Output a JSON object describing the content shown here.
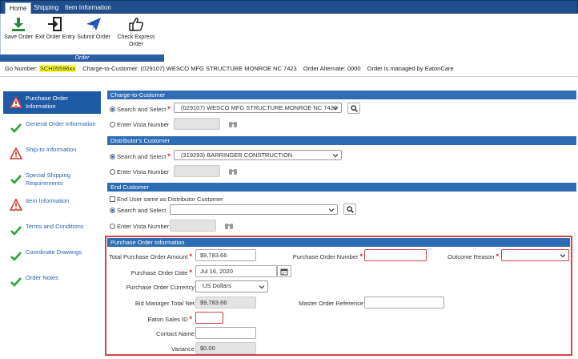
{
  "tabs": [
    "Home",
    "Shipping",
    "Item Information"
  ],
  "ribbon": {
    "buttons": [
      {
        "label": "Save Order",
        "icon": "download-icon"
      },
      {
        "label": "Exit Order Entry",
        "icon": "exit-icon"
      },
      {
        "label": "Submit Order",
        "icon": "paper-plane-icon"
      },
      {
        "label": "Check Express Order",
        "icon": "thumbs-up-icon"
      }
    ],
    "group_label": "Order"
  },
  "info": {
    "go_number_label": "Go Number:",
    "go_number": "SCH05596xx",
    "charge_to": "Charge-to-Customer: (029107) WESCO MFG STRUCTURE MONROE NC 7423",
    "order_alternate": "Order Alternate: 0000",
    "managed_by": "Order is managed by EatonCare"
  },
  "sidebar": {
    "items": [
      {
        "label": "Purchase Order Information",
        "status": "warning",
        "active": true
      },
      {
        "label": "General Order Information",
        "status": "ok"
      },
      {
        "label": "Ship-to Information",
        "status": "warning"
      },
      {
        "label": "Special Shipping Requirements",
        "status": "ok"
      },
      {
        "label": "Item Information",
        "status": "warning"
      },
      {
        "label": "Terms and Conditions",
        "status": "ok"
      },
      {
        "label": "Coordinate Drawings",
        "status": "ok"
      },
      {
        "label": "Order Notes",
        "status": "ok"
      }
    ]
  },
  "charge": {
    "title": "Charge-to-Customer",
    "search_label": "Search and Select",
    "selected": "(029107) WESCO MFG STRUCTURE MONROE NC 7423",
    "vista_label": "Enter Vista Number"
  },
  "distributor": {
    "title": "Distributor's Customer",
    "search_label": "Search and Select",
    "selected": "(319293) BARRINGER CONSTRUCTION",
    "vista_label": "Enter Vista Number"
  },
  "end_customer": {
    "title": "End Customer",
    "same_label": "End User same as Distributor Customer",
    "search_label": "Search and Select",
    "selected": "",
    "vista_label": "Enter Vista Number"
  },
  "po": {
    "title": "Purchase Order Information",
    "total_amount_label": "Total Purchase Order Amount",
    "total_amount": "$9,783.66",
    "po_number_label": "Purchase Order Number",
    "po_number": "",
    "outcome_label": "Outcome Reason",
    "outcome": "",
    "date_label": "Purchase Order Date",
    "date": "Jul 16, 2020",
    "currency_label": "Purchase Order Currency",
    "currency": "US Dollars",
    "bid_total_label": "Bid Manager Total Net",
    "bid_total": "$9,783.66",
    "master_ref_label": "Master Order Reference",
    "master_ref": "",
    "sales_id_label": "Eaton Sales ID",
    "sales_id": "",
    "contact_label": "Contact Name",
    "contact": "",
    "variance_label": "Variance",
    "variance": "$0.00"
  },
  "colors": {
    "header_blue": "#2e6db5",
    "tab_blue": "#1f4e8c",
    "ok_green": "#2aa53a",
    "warn_red": "#d23a2e",
    "highlight": "#ffff33"
  }
}
